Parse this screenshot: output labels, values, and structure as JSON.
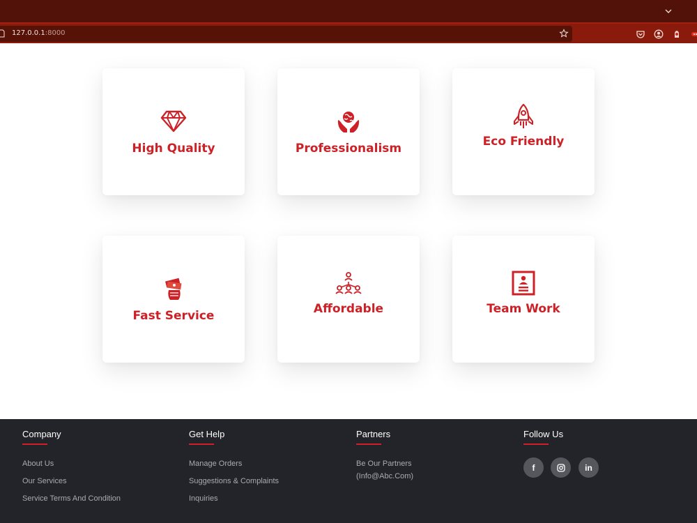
{
  "browser": {
    "url_host": "127.0.0.1",
    "url_port": ":8000"
  },
  "colors": {
    "accent": "#cc2127",
    "chrome_dark": "#521209",
    "chrome_bar": "#8a1a0c",
    "footer_bg": "#232429"
  },
  "features": [
    {
      "title": "High Quality",
      "icon": "diamond-icon"
    },
    {
      "title": "Professionalism",
      "icon": "hands-globe-icon"
    },
    {
      "title": "Eco Friendly",
      "icon": "rocket-icon"
    },
    {
      "title": "Fast Service",
      "icon": "money-hand-icon"
    },
    {
      "title": "Affordable",
      "icon": "network-people-icon"
    },
    {
      "title": "Team Work",
      "icon": "id-card-icon"
    }
  ],
  "footer": {
    "company": {
      "heading": "Company",
      "links": [
        "About Us",
        "Our Services",
        "Service Terms And Condition"
      ]
    },
    "help": {
      "heading": "Get Help",
      "links": [
        "Manage Orders",
        "Suggestions & Complaints",
        "Inquiries"
      ]
    },
    "partners": {
      "heading": "Partners",
      "line1": "Be Our Partners",
      "line2": "(Info@Abc.Com)"
    },
    "follow": {
      "heading": "Follow Us",
      "facebook": "f",
      "instagram": "instagram-icon",
      "linkedin": "in"
    }
  }
}
